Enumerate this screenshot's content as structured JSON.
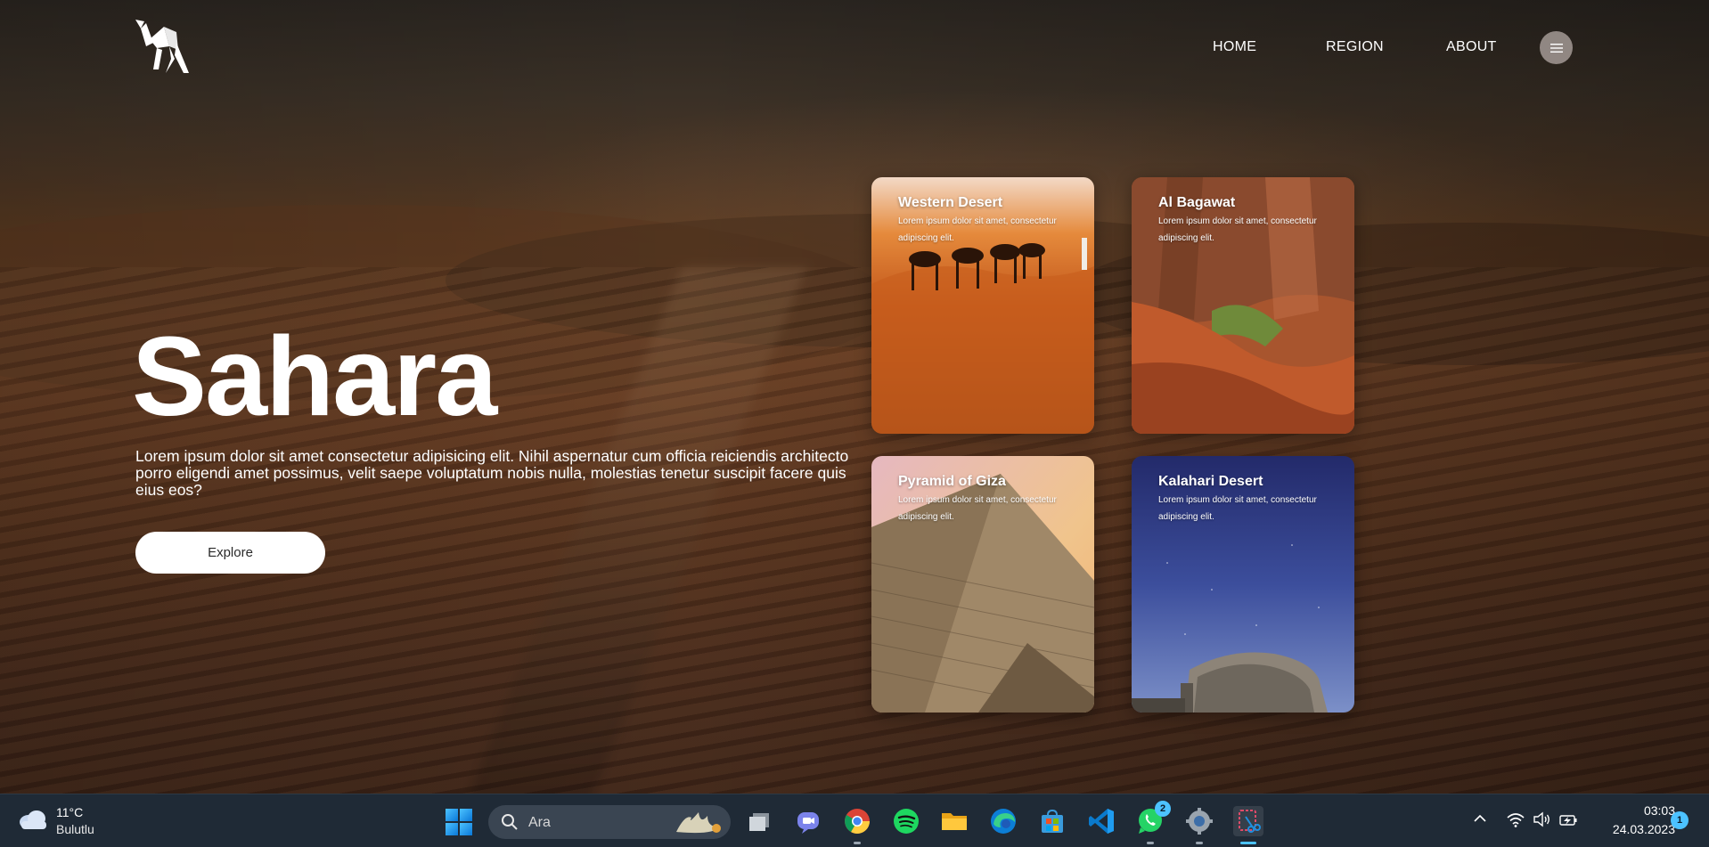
{
  "header": {
    "logo_icon": "origami-camel-logo-icon",
    "nav": [
      {
        "label": "HOME"
      },
      {
        "label": "REGION"
      },
      {
        "label": "ABOUT"
      }
    ],
    "menu_icon": "hamburger-menu-icon"
  },
  "hero": {
    "title": "Sahara",
    "description": "Lorem ipsum dolor sit amet consectetur adipisicing elit. Nihil aspernatur cum officia reiciendis architecto porro eligendi amet possimus, velit saepe voluptatum nobis nulla, molestias tenetur suscipit facere quis eius eos?",
    "button_label": "Explore"
  },
  "cards": [
    {
      "title": "Western Desert",
      "text": "Lorem ipsum dolor sit amet, consectetur adipiscing elit."
    },
    {
      "title": "Al Bagawat",
      "text": "Lorem ipsum dolor sit amet, consectetur adipiscing elit."
    },
    {
      "title": "Pyramid of Giza",
      "text": "Lorem ipsum dolor sit amet, consectetur adipiscing elit."
    },
    {
      "title": "Kalahari Desert",
      "text": "Lorem ipsum dolor sit amet, consectetur adipiscing elit."
    }
  ],
  "taskbar": {
    "weather": {
      "temp": "11°C",
      "condition": "Bulutlu",
      "icon": "cloud-icon"
    },
    "search_placeholder": "Ara",
    "apps": [
      {
        "name": "task-view-icon"
      },
      {
        "name": "teams-chat-icon"
      },
      {
        "name": "chrome-icon"
      },
      {
        "name": "spotify-icon"
      },
      {
        "name": "file-explorer-icon"
      },
      {
        "name": "edge-icon"
      },
      {
        "name": "microsoft-store-icon"
      },
      {
        "name": "vscode-icon"
      },
      {
        "name": "whatsapp-icon",
        "badge": "2"
      },
      {
        "name": "settings-icon"
      },
      {
        "name": "snipping-tool-icon"
      }
    ],
    "clock": {
      "time": "03:03",
      "date": "24.03.2023"
    },
    "notification_count": "1"
  },
  "colors": {
    "accent": "#4cc2ff",
    "taskbar_bg": "#1f2a36",
    "button_bg": "#ffffff"
  }
}
